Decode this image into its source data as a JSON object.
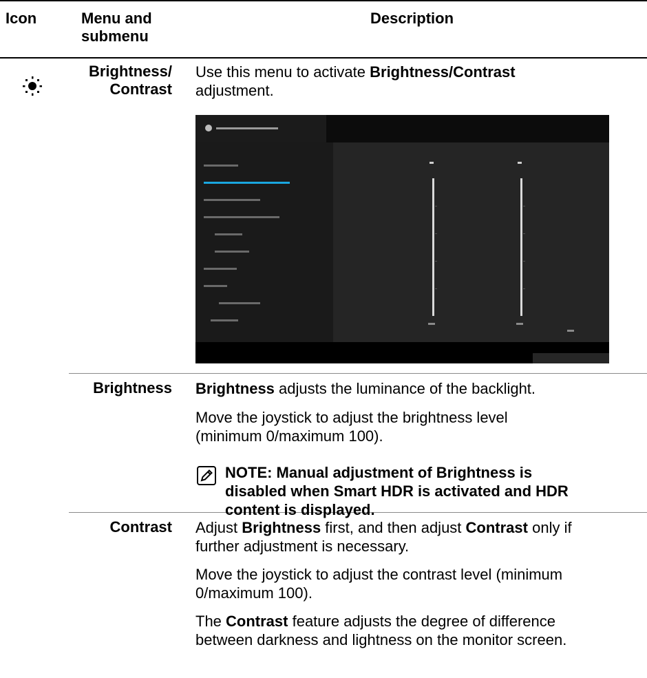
{
  "table": {
    "headers": {
      "icon": "Icon",
      "menu_line1": "Menu and",
      "menu_line2": "submenu",
      "description": "Description"
    },
    "section": {
      "menu_line1": "Brightness/",
      "menu_line2": "Contrast",
      "icon": "brightness-sun-icon",
      "desc_line1_pre": "Use this menu to activate ",
      "desc_line1_bold": "Brightness/Contrast",
      "desc_line2": "adjustment."
    },
    "brightness": {
      "label": "Brightness",
      "p1_bold": "Brightness",
      "p1_rest": " adjusts the luminance of the backlight.",
      "p2_line1": "Move the joystick to adjust the brightness level",
      "p2_line2": "(minimum 0/maximum 100).",
      "note_line1": "NOTE: Manual adjustment of Brightness is",
      "note_line2": "disabled when Smart HDR is activated and HDR",
      "note_line3": "content is displayed.",
      "note_icon": "pencil-note-icon"
    },
    "contrast": {
      "label": "Contrast",
      "p1_a": "Adjust ",
      "p1_b": "Brightness",
      "p1_c": " first, and then adjust ",
      "p1_d": "Contrast",
      "p1_e": " only if",
      "p1_line2": "further adjustment is necessary.",
      "p2_line1": "Move the joystick to adjust the contrast level (minimum",
      "p2_line2": "0/maximum 100).",
      "p3_a": "The ",
      "p3_b": "Contrast",
      "p3_c": " feature adjusts the degree of difference",
      "p3_line2": "between darkness and lightness on the monitor screen."
    }
  },
  "colors": {
    "osd_selected": "#1aa7e0",
    "osd_background": "#1c1c1c"
  }
}
